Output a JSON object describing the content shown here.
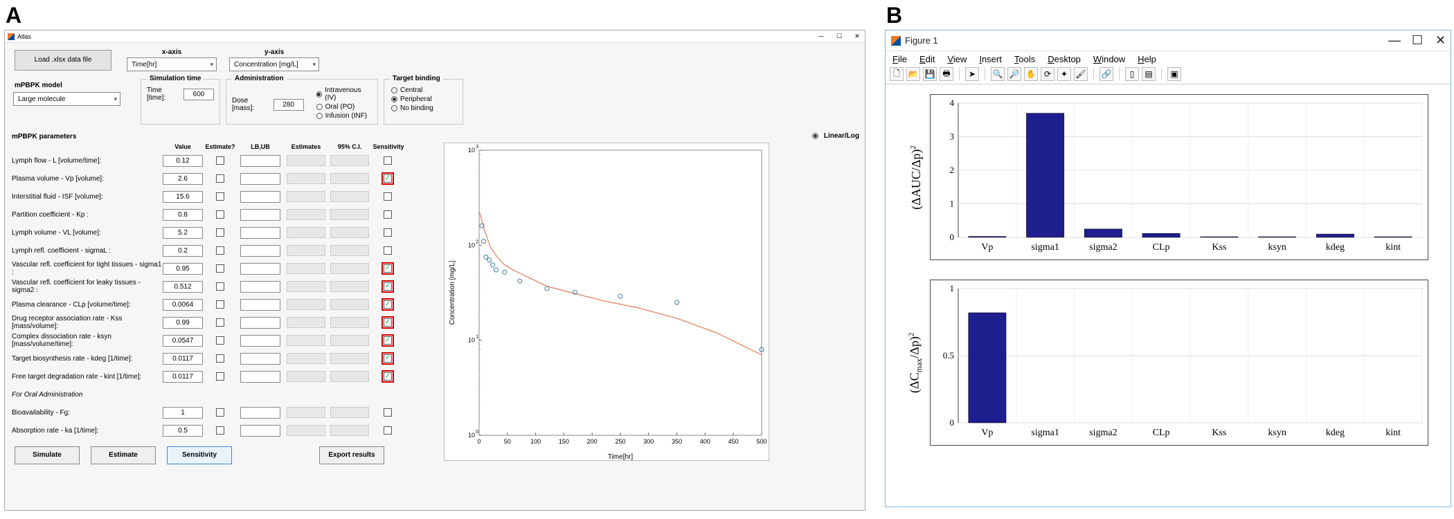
{
  "labels": {
    "A": "A",
    "B": "B"
  },
  "atlas": {
    "title": "Atlas",
    "load_btn": "Load .xlsx data file",
    "xaxis": {
      "hdr": "x-axis",
      "value": "Time[hr]"
    },
    "yaxis": {
      "hdr": "y-axis",
      "value": "Concentration [mg/L]"
    },
    "model": {
      "hdr": "mPBPK model",
      "value": "Large molecule"
    },
    "sim": {
      "hdr": "Simulation time",
      "label": "Time [time]:",
      "value": "600"
    },
    "admin": {
      "hdr": "Administration",
      "dose_label": "Dose [mass]:",
      "dose_value": "280",
      "routes": [
        "Intravenous (IV)",
        "Oral (PO)",
        "Infusion (INF)"
      ],
      "selected": 0
    },
    "target": {
      "hdr": "Target binding",
      "options": [
        "Central",
        "Peripheral",
        "No binding"
      ],
      "selected": 1
    },
    "plot_mode": {
      "label": "Linear/Log",
      "selected": true
    },
    "params_title": "mPBPK parameters",
    "col_hdrs": [
      "Value",
      "Estimate?",
      "LB,UB",
      "Estimates",
      "95% C.I.",
      "Sensitivity"
    ],
    "rows": [
      {
        "id": "L",
        "label": "Lymph flow - L [volume/time]:",
        "value": "0.12",
        "sens": false,
        "hl": false,
        "italic": false,
        "has_val": true
      },
      {
        "id": "Vp",
        "label": "Plasma volume - Vp [volume]:",
        "value": "2.6",
        "sens": true,
        "hl": true,
        "italic": false,
        "has_val": true
      },
      {
        "id": "ISF",
        "label": "Interstitial fluid - ISF [volume]:",
        "value": "15.6",
        "sens": false,
        "hl": false,
        "italic": false,
        "has_val": true
      },
      {
        "id": "Kp",
        "label": "Partition coefficient - Kp :",
        "value": "0.8",
        "sens": false,
        "hl": false,
        "italic": false,
        "has_val": true
      },
      {
        "id": "VL",
        "label": "Lymph volume - VL [volume]:",
        "value": "5.2",
        "sens": false,
        "hl": false,
        "italic": false,
        "has_val": true
      },
      {
        "id": "sigmaL",
        "label": "Lymph refl. coefficient - sigmaL :",
        "value": "0.2",
        "sens": false,
        "hl": false,
        "italic": false,
        "has_val": true
      },
      {
        "id": "sigma1",
        "label": "Vascular refl. coefficient for tight tissues - sigma1 :",
        "value": "0.95",
        "sens": true,
        "hl": true,
        "italic": false,
        "has_val": true
      },
      {
        "id": "sigma2",
        "label": "Vascular refl. coefficient for leaky tissues - sigma2 :",
        "value": "0.512",
        "sens": true,
        "hl": true,
        "italic": false,
        "has_val": true
      },
      {
        "id": "CLp",
        "label": "Plasma clearance - CLp [volume/time]:",
        "value": "0.0064",
        "sens": true,
        "hl": true,
        "italic": false,
        "has_val": true
      },
      {
        "id": "Kss",
        "label": "Drug receptor association rate - Kss [mass/volume]:",
        "value": "0.99",
        "sens": true,
        "hl": true,
        "italic": false,
        "has_val": true
      },
      {
        "id": "ksyn",
        "label": "Complex dissociation rate - ksyn [mass/volume/time]:",
        "value": "0.0547",
        "sens": true,
        "hl": true,
        "italic": false,
        "has_val": true
      },
      {
        "id": "kdeg",
        "label": "Target biosynthesis rate - kdeg [1/time]:",
        "value": "0.0117",
        "sens": true,
        "hl": true,
        "italic": false,
        "has_val": true
      },
      {
        "id": "kint",
        "label": "Free target degradation rate - kint [1/time]:",
        "value": "0.0117",
        "sens": true,
        "hl": true,
        "italic": false,
        "has_val": true
      },
      {
        "id": "oralhdr",
        "label": "For Oral Administration",
        "value": "",
        "sens": false,
        "hl": false,
        "italic": true,
        "has_val": false
      },
      {
        "id": "Fg",
        "label": "Bioavailability - Fg:",
        "value": "1",
        "sens": false,
        "hl": false,
        "italic": false,
        "has_val": true
      },
      {
        "id": "ka",
        "label": "Absorption rate - ka [1/time]:",
        "value": "0.5",
        "sens": false,
        "hl": false,
        "italic": false,
        "has_val": true
      }
    ],
    "buttons": {
      "simulate": "Simulate",
      "estimate": "Estimate",
      "sensitivity": "Sensitivity",
      "export": "Export results"
    }
  },
  "fig": {
    "title": "Figure 1",
    "menu": [
      "File",
      "Edit",
      "View",
      "Insert",
      "Tools",
      "Desktop",
      "Window",
      "Help"
    ]
  },
  "chart_data": [
    {
      "type": "line-log",
      "title": "",
      "xlabel": "Time[hr]",
      "ylabel": "Concentration [mg/L]",
      "xlim": [
        0,
        500
      ],
      "xticks": [
        0,
        50,
        100,
        150,
        200,
        250,
        300,
        350,
        400,
        450,
        500
      ],
      "ylim_log": [
        0,
        3
      ],
      "yticks_log": [
        0,
        1,
        2,
        3
      ],
      "series": [
        {
          "name": "model",
          "kind": "line",
          "color": "#e58b6a",
          "x": [
            0,
            10,
            20,
            30,
            45,
            60,
            80,
            120,
            160,
            220,
            280,
            350,
            420,
            500
          ],
          "y": [
            230,
            140,
            95,
            78,
            62,
            55,
            48,
            37,
            32,
            26,
            22,
            17,
            12,
            7
          ]
        },
        {
          "name": "data",
          "kind": "scatter",
          "color": "#3b7b9c",
          "points": [
            [
              5,
              160
            ],
            [
              8,
              110
            ],
            [
              12,
              75
            ],
            [
              18,
              70
            ],
            [
              24,
              62
            ],
            [
              30,
              55
            ],
            [
              45,
              52
            ],
            [
              72,
              42
            ],
            [
              120,
              35
            ],
            [
              170,
              32
            ],
            [
              250,
              29
            ],
            [
              350,
              25
            ],
            [
              500,
              8
            ]
          ]
        }
      ]
    },
    {
      "type": "bar",
      "ylabel": "(ΔAUC/Δp)²",
      "categories": [
        "Vp",
        "sigma1",
        "sigma2",
        "CLp",
        "Kss",
        "ksyn",
        "kdeg",
        "kint"
      ],
      "values": [
        0.03,
        3.7,
        0.25,
        0.12,
        0.02,
        0.02,
        0.1,
        0.02
      ],
      "ylim": [
        0,
        4
      ],
      "yticks": [
        0,
        1,
        2,
        3,
        4
      ],
      "color": "#1f1e8e"
    },
    {
      "type": "bar",
      "ylabel": "(ΔCmax/Δp)²",
      "categories": [
        "Vp",
        "sigma1",
        "sigma2",
        "CLp",
        "Kss",
        "ksyn",
        "kdeg",
        "kint"
      ],
      "values": [
        0.82,
        0.0,
        0.0,
        0.0,
        0.0,
        0.0,
        0.0,
        0.0
      ],
      "ylim": [
        0,
        1
      ],
      "yticks": [
        0,
        0.5,
        1
      ],
      "color": "#1f1e8e"
    }
  ]
}
